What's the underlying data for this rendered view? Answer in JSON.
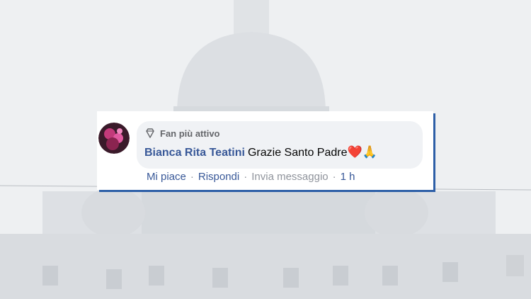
{
  "badge_label": "Fan più attivo",
  "author": "Bianca Rita Teatini",
  "comment_text": "Grazie Santo Padre",
  "emojis": [
    "❤️",
    "🙏"
  ],
  "actions": {
    "like": "Mi piace",
    "reply": "Rispondi",
    "message": "Invia messaggio",
    "time": "1 h"
  },
  "icons": {
    "badge": "diamond-icon"
  },
  "colors": {
    "author_link": "#385898",
    "bubble_bg": "#f0f2f5",
    "card_shadow": "#2d5fa7",
    "heart": "#e0242a"
  }
}
